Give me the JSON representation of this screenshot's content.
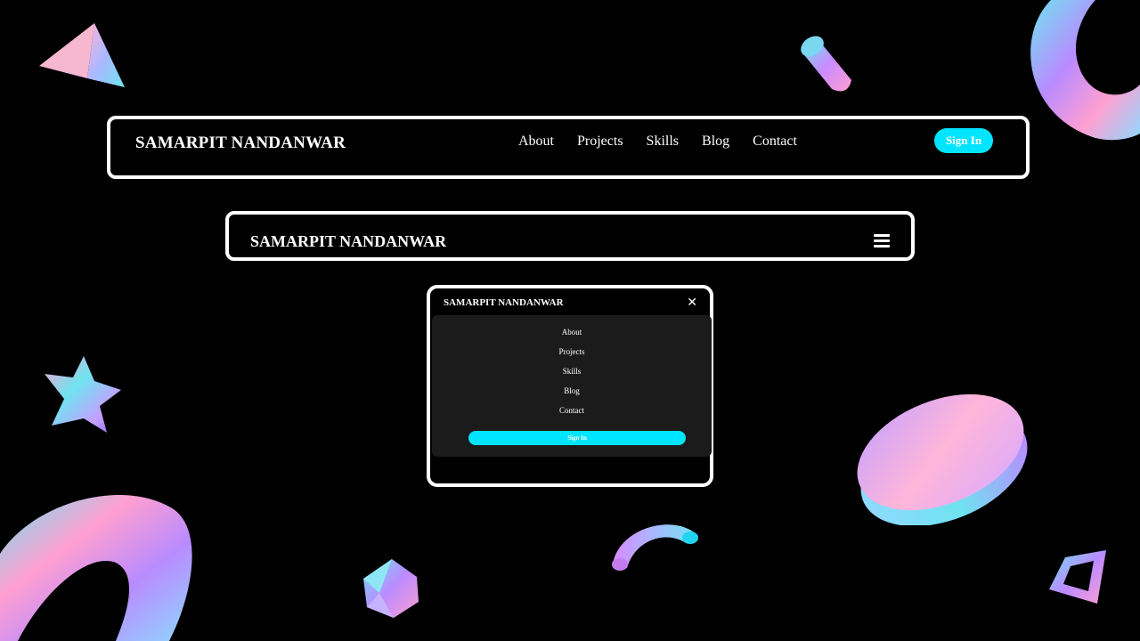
{
  "desktop": {
    "brand": "SAMARPIT NANDANWAR",
    "links": [
      "About",
      "Projects",
      "Skills",
      "Blog",
      "Contact"
    ],
    "signin": "Sign In"
  },
  "tablet": {
    "brand": "SAMARPIT NANDANWAR",
    "menu_icon": "hamburger-icon"
  },
  "mobile": {
    "brand": "SAMARPIT NANDANWAR",
    "close_icon": "close-icon",
    "close_glyph": "✕",
    "links": [
      "About",
      "Projects",
      "Skills",
      "Blog",
      "Contact"
    ],
    "signin": "Sign In"
  },
  "colors": {
    "background": "#000000",
    "accent": "#00e5ff",
    "border": "#ffffff",
    "panel": "#1b1b1b"
  }
}
